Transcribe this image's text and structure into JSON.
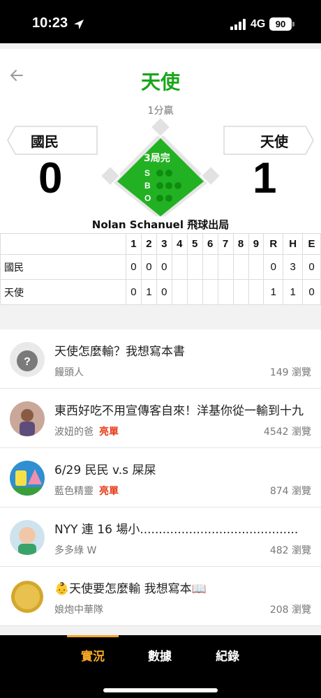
{
  "status": {
    "time": "10:23",
    "network": "4G",
    "battery": "90"
  },
  "game": {
    "winner_title": "天使",
    "margin": "1分贏",
    "away_team": "國民",
    "home_team": "天使",
    "away_score": "0",
    "home_score": "1",
    "inning_status": "3局完",
    "count_labels": [
      "S",
      "B",
      "O"
    ],
    "last_play": "Nolan Schanuel 飛球出局",
    "accent_color": "#22b122"
  },
  "linescore": {
    "headers": [
      "",
      "1",
      "2",
      "3",
      "4",
      "5",
      "6",
      "7",
      "8",
      "9",
      "R",
      "H",
      "E"
    ],
    "rows": [
      {
        "team": "國民",
        "cells": [
          "0",
          "0",
          "0",
          "",
          "",
          "",
          "",
          "",
          "",
          "0",
          "3",
          "0"
        ]
      },
      {
        "team": "天使",
        "cells": [
          "0",
          "1",
          "0",
          "",
          "",
          "",
          "",
          "",
          "",
          "1",
          "1",
          "0"
        ]
      }
    ]
  },
  "posts": [
    {
      "title": "天使怎麼輸？我想寫本書",
      "author": "饅頭人",
      "tag": "",
      "views": "149 瀏覽",
      "avatar": "question-avatar"
    },
    {
      "title": "東西好吃不用宣傳客自來！洋基你從一輸到十九",
      "author": "波妞的爸",
      "tag": "亮單",
      "views": "4542 瀏覽",
      "avatar": "child-avatar"
    },
    {
      "title": "6/29 民民 v.s 屎屎",
      "author": "藍色精靈",
      "tag": "亮單",
      "views": "874 瀏覽",
      "avatar": "cartoon-avatar"
    },
    {
      "title": "NYY 連 16 場小..........................................",
      "author": "多多綠 W",
      "tag": "",
      "views": "482 瀏覽",
      "avatar": "baby-avatar"
    },
    {
      "title": "👶天使要怎麼輸 我想寫本📖",
      "author": "娘炮中華隊",
      "tag": "",
      "views": "208 瀏覽",
      "avatar": "coin-avatar"
    }
  ],
  "tabs": [
    "實況",
    "數據",
    "紀錄"
  ]
}
